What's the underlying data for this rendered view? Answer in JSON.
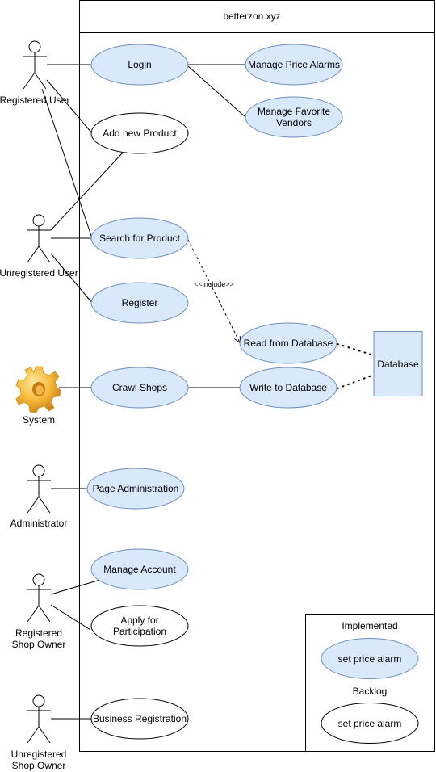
{
  "system": {
    "title": "betterzon.xyz"
  },
  "colors": {
    "implemented_fill": "#dae8fc",
    "implemented_stroke": "#6c8ebf",
    "backlog_fill": "#ffffff",
    "line": "#000000"
  },
  "actors": [
    {
      "id": "registered-user",
      "label": [
        "Registered User"
      ],
      "icon": "stick-figure-icon"
    },
    {
      "id": "unregistered-user",
      "label": [
        "Unregistered User"
      ],
      "icon": "stick-figure-icon"
    },
    {
      "id": "system",
      "label": [
        "System"
      ],
      "icon": "gear-icon"
    },
    {
      "id": "administrator",
      "label": [
        "Administrator"
      ],
      "icon": "stick-figure-icon"
    },
    {
      "id": "registered-shop-owner",
      "label": [
        "Registered",
        "Shop Owner"
      ],
      "icon": "stick-figure-icon"
    },
    {
      "id": "unregistered-shop-owner",
      "label": [
        "Unregistered",
        "Shop Owner"
      ],
      "icon": "stick-figure-icon"
    }
  ],
  "use_cases": [
    {
      "id": "login",
      "label": [
        "Login"
      ],
      "status": "implemented"
    },
    {
      "id": "manage-price-alarms",
      "label": [
        "Manage Price Alarms"
      ],
      "status": "implemented"
    },
    {
      "id": "manage-favorite-vendors",
      "label": [
        "Manage Favorite",
        "Vendors"
      ],
      "status": "implemented"
    },
    {
      "id": "add-new-product",
      "label": [
        "Add new Product"
      ],
      "status": "backlog"
    },
    {
      "id": "search-for-product",
      "label": [
        "Search for Product"
      ],
      "status": "implemented"
    },
    {
      "id": "register",
      "label": [
        "Register"
      ],
      "status": "implemented"
    },
    {
      "id": "read-from-database",
      "label": [
        "Read from Database"
      ],
      "status": "implemented"
    },
    {
      "id": "crawl-shops",
      "label": [
        "Crawl Shops"
      ],
      "status": "implemented"
    },
    {
      "id": "write-to-database",
      "label": [
        "Write to Database"
      ],
      "status": "implemented"
    },
    {
      "id": "page-administration",
      "label": [
        "Page Administration"
      ],
      "status": "implemented"
    },
    {
      "id": "manage-account",
      "label": [
        "Manage Account"
      ],
      "status": "implemented"
    },
    {
      "id": "apply-for-participation",
      "label": [
        "Apply for",
        "Participation"
      ],
      "status": "backlog"
    },
    {
      "id": "business-registration",
      "label": [
        "Business Registration"
      ],
      "status": "backlog"
    }
  ],
  "database": {
    "label": "Database"
  },
  "include_label": "<<include>>",
  "legend": {
    "implemented_title": "Implemented",
    "implemented_example": "set price alarm",
    "backlog_title": "Backlog",
    "backlog_example": "set price alarm"
  }
}
